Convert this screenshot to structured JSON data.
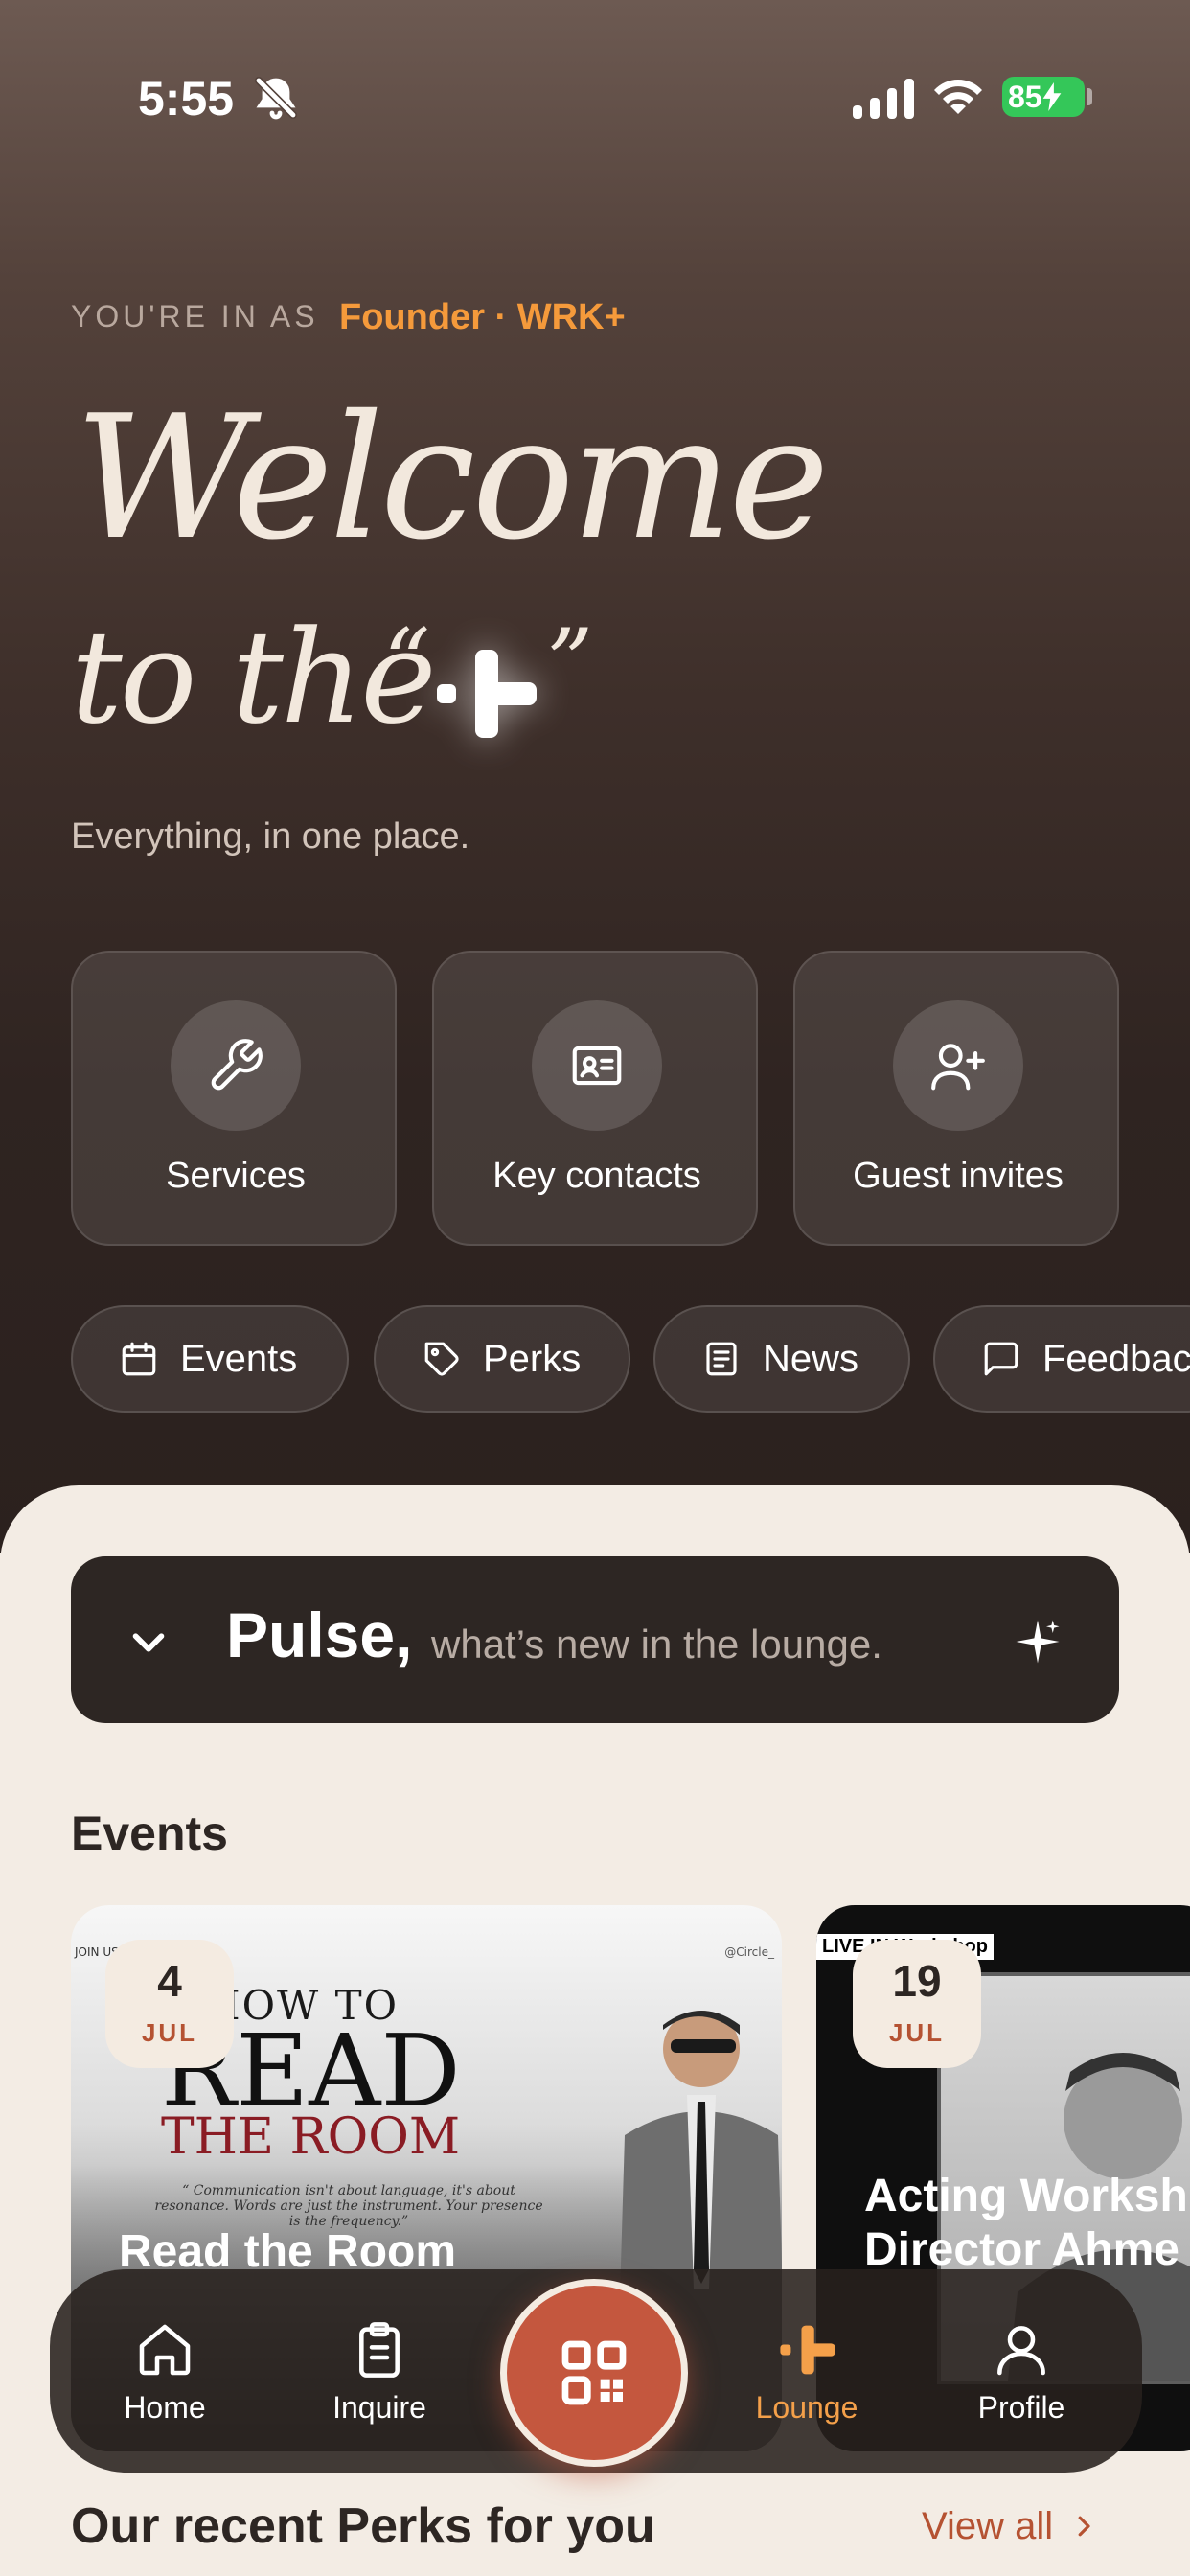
{
  "status_bar": {
    "time": "5:55",
    "battery": "85"
  },
  "header": {
    "role_label": "YOU'RE IN AS",
    "role_value": "Founder · WRK+",
    "welcome_line1": "Welcome",
    "welcome_line2": "to the",
    "quote_open": "“",
    "quote_close": "”",
    "tagline": "Everything, in one place."
  },
  "tiles": [
    {
      "label": "Services",
      "icon": "wrench-icon"
    },
    {
      "label": "Key contacts",
      "icon": "contact-card-icon"
    },
    {
      "label": "Guest invites",
      "icon": "add-user-icon"
    }
  ],
  "chips": [
    {
      "label": "Events",
      "icon": "calendar-icon"
    },
    {
      "label": "Perks",
      "icon": "tag-icon"
    },
    {
      "label": "News",
      "icon": "newspaper-icon"
    },
    {
      "label": "Feedback",
      "icon": "chat-icon"
    }
  ],
  "pulse": {
    "title": "Pulse,",
    "subtitle": "what’s new in the lounge."
  },
  "events": {
    "heading": "Events",
    "items": [
      {
        "day": "4",
        "month": "JUL",
        "title": "Read the Room",
        "poster": {
          "line1": "HOW TO",
          "line2": "READ",
          "line3": "THE ROOM",
          "quote": "“ Communication isn't about language, it's about resonance. Words are just the instrument. Your presence is the frequency.”",
          "tag_left": "JOIN US",
          "tag_right": "@Circle_"
        }
      },
      {
        "day": "19",
        "month": "JUL",
        "title": "Acting Worksh",
        "title2": "Director Ahme",
        "poster": {
          "tag": "LIVE IN Workshop"
        }
      }
    ]
  },
  "tabbar": {
    "items": [
      {
        "label": "Home",
        "icon": "home-icon"
      },
      {
        "label": "Inquire",
        "icon": "clipboard-icon"
      },
      {
        "label": "Lounge",
        "icon": "plus-logo-icon"
      },
      {
        "label": "Profile",
        "icon": "user-icon"
      }
    ],
    "active": "Lounge",
    "center_icon": "qr-code-icon"
  },
  "perks": {
    "heading": "Our recent Perks for you",
    "view_all": "View all"
  },
  "colors": {
    "accent_orange": "#f59a3b",
    "brand_terracotta": "#c4573e",
    "sheet_bg": "#f3ece4",
    "dark_panel": "#2d2623"
  }
}
